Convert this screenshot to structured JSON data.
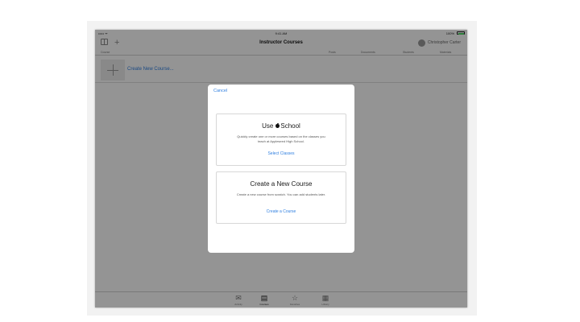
{
  "status_bar": {
    "carrier": "••••• ᯤ",
    "time": "9:41 AM",
    "battery_text": "100%",
    "battery_color": "#4cd964"
  },
  "nav": {
    "title": "Instructor Courses",
    "user_name": "Christopher Carter",
    "add_symbol": "+",
    "sidebar_icon": "sidebar-icon"
  },
  "columns": {
    "course": "Course",
    "posts": "Posts",
    "documents": "Documents",
    "students": "Students",
    "materials": "Materials"
  },
  "list": {
    "create_label": "Create New Course..."
  },
  "tabs": [
    {
      "label": "Activity",
      "icon": "✉"
    },
    {
      "label": "Courses",
      "icon": "▤"
    },
    {
      "label": "Favorites",
      "icon": "☆"
    },
    {
      "label": "Library",
      "icon": "▦"
    }
  ],
  "modal": {
    "cancel": "Cancel",
    "school_card": {
      "title_prefix": "Use",
      "title_suffix": "School",
      "description": "Quickly create one or more courses based on the classes you teach at Appleseed High School.",
      "action": "Select Classes"
    },
    "new_card": {
      "title": "Create a New Course",
      "description": "Create a new course from scratch. You can add students later.",
      "action": "Create a Course"
    }
  },
  "colors": {
    "accent": "#2f7fe0",
    "dim_overlay": "rgba(0,0,0,0.42)"
  }
}
